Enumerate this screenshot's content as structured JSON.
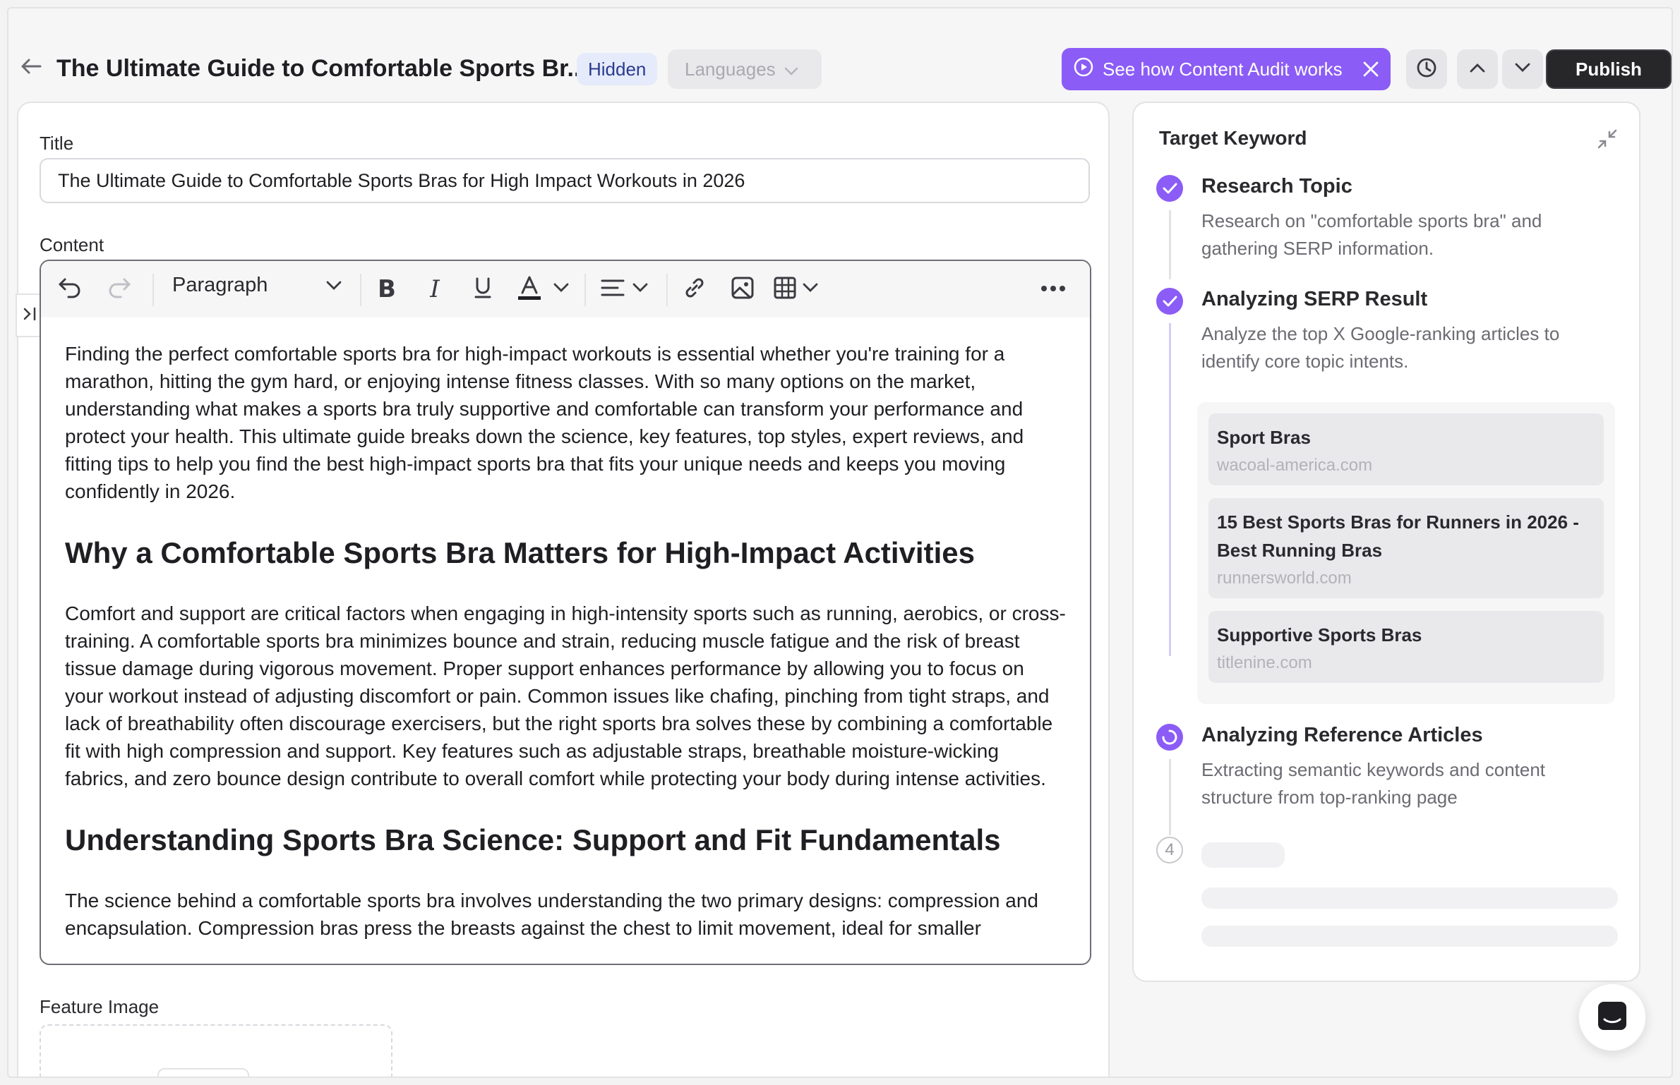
{
  "header": {
    "title": "The Ultimate Guide to Comfortable Sports Br...",
    "status_badge": "Hidden",
    "languages_label": "Languages",
    "audit_label": "See how Content Audit works",
    "publish_label": "Publish"
  },
  "editor": {
    "title_label": "Title",
    "title_value": "The Ultimate Guide to Comfortable Sports Bras for High Impact Workouts in 2026",
    "content_label": "Content",
    "block_type": "Paragraph",
    "body": [
      {
        "type": "p",
        "text": "Finding the perfect comfortable sports bra for high-impact workouts is essential whether you're training for a marathon, hitting the gym hard, or enjoying intense fitness classes. With so many options on the market, understanding what makes a sports bra truly supportive and comfortable can transform your performance and protect your health. This ultimate guide breaks down the science, key features, top styles, expert reviews, and fitting tips to help you find the best high-impact sports bra that fits your unique needs and keeps you moving confidently in 2026."
      },
      {
        "type": "h2",
        "text": "Why a Comfortable Sports Bra Matters for High-Impact Activities"
      },
      {
        "type": "p",
        "text": "Comfort and support are critical factors when engaging in high-intensity sports such as running, aerobics, or cross-training. A comfortable sports bra minimizes bounce and strain, reducing muscle fatigue and the risk of breast tissue damage during vigorous movement. Proper support enhances performance by allowing you to focus on your workout instead of adjusting discomfort or pain. Common issues like chafing, pinching from tight straps, and lack of breathability often discourage exercisers, but the right sports bra solves these by combining a comfortable fit with high compression and support. Key features such as adjustable straps, breathable moisture-wicking fabrics, and zero bounce design contribute to overall comfort while protecting your body during intense activities."
      },
      {
        "type": "h2",
        "text": "Understanding Sports Bra Science: Support and Fit Fundamentals"
      },
      {
        "type": "p",
        "text": "The science behind a comfortable sports bra involves understanding the two primary designs: compression and encapsulation. Compression bras press the breasts against the chest to limit movement, ideal for smaller"
      }
    ],
    "feature_image_label": "Feature Image"
  },
  "keyword_panel": {
    "title": "Target Keyword",
    "steps": [
      {
        "title": "Research Topic",
        "desc": "Research on \"comfortable sports bra\" and gathering SERP information.",
        "state": "done"
      },
      {
        "title": "Analyzing SERP Result",
        "desc": "Analyze the top X Google-ranking articles to identify core topic intents.",
        "state": "done"
      },
      {
        "title": "Analyzing Reference Articles",
        "desc": "Extracting semantic keywords and content structure from top-ranking page",
        "state": "in-progress"
      },
      {
        "number": "4",
        "state": "pending"
      }
    ],
    "serp_results": [
      {
        "title": "Sport Bras",
        "source": "wacoal-america.com"
      },
      {
        "title": "15 Best Sports Bras for Runners in 2026 - Best Running Bras",
        "source": "runnersworld.com"
      },
      {
        "title": "Supportive Sports Bras",
        "source": "titlenine.com"
      }
    ]
  },
  "colors": {
    "accent": "#8b5cf6",
    "publish_bg": "#27272a",
    "badge_bg": "#e6ebfb"
  },
  "icons": [
    "back-arrow-icon",
    "chevron-down-icon",
    "play-circle-icon",
    "close-icon",
    "clock-icon",
    "chevron-up-icon",
    "undo-icon",
    "redo-icon",
    "bold-icon",
    "italic-icon",
    "underline-icon",
    "text-color-icon",
    "align-icon",
    "link-icon",
    "image-icon",
    "table-icon",
    "more-icon",
    "collapse-icon",
    "check-icon",
    "spinner-icon",
    "chat-icon",
    "sidebar-expand-icon"
  ]
}
